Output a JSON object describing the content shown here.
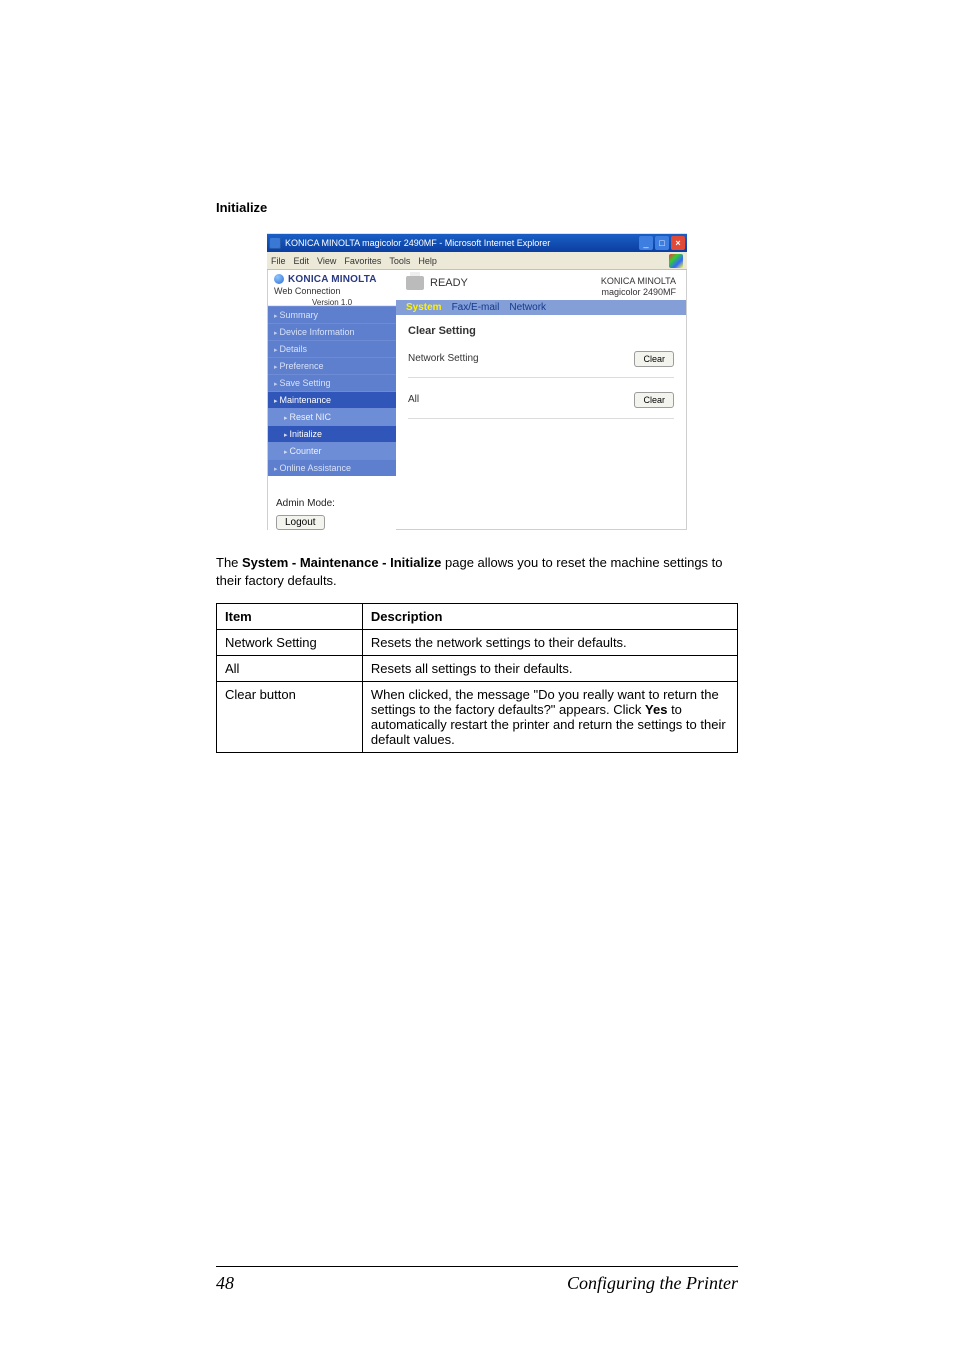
{
  "section_heading": "Initialize",
  "screenshot": {
    "window_title": "KONICA MINOLTA magicolor 2490MF - Microsoft Internet Explorer",
    "win_min": "_",
    "win_max": "□",
    "win_close": "×",
    "menu": {
      "file": "File",
      "edit": "Edit",
      "view": "View",
      "favorites": "Favorites",
      "tools": "Tools",
      "help": "Help"
    },
    "brand": {
      "name": "KONICA MINOLTA",
      "product": "Web Connection",
      "version": "Version 1.0"
    },
    "nav": {
      "summary": "Summary",
      "device_info": "Device Information",
      "details": "Details",
      "preference": "Preference",
      "save_setting": "Save Setting",
      "maintenance": "Maintenance",
      "reset_nic": "Reset NIC",
      "initialize": "Initialize",
      "counter": "Counter",
      "online_assistance": "Online Assistance"
    },
    "admin_section": {
      "label": "Admin Mode:",
      "logout": "Logout"
    },
    "status": {
      "ready": "READY",
      "brand_right_1": "KONICA MINOLTA",
      "brand_right_2": "magicolor 2490MF"
    },
    "tabs": {
      "system": "System",
      "fax": "Fax/E-mail",
      "network": "Network"
    },
    "panel": {
      "heading": "Clear Setting",
      "row1_label": "Network Setting",
      "row2_label": "All",
      "clear_label": "Clear"
    }
  },
  "paragraph": {
    "pre": "The ",
    "strong": "System - Maintenance - Initialize",
    "post": " page allows you to reset the machine settings to their factory defaults."
  },
  "table": {
    "head_item": "Item",
    "head_desc": "Description",
    "rows": [
      {
        "item": "Network Setting",
        "desc": "Resets the network settings to their defaults."
      },
      {
        "item": "All",
        "desc": "Resets all settings to their defaults."
      },
      {
        "item": "Clear button",
        "desc_pre": "When clicked, the message \"Do you really want to return the settings to the factory defaults?\" appears. Click ",
        "desc_bold": "Yes",
        "desc_post": " to automatically restart the printer and return the settings to their default values."
      }
    ]
  },
  "footer": {
    "page": "48",
    "chapter": "Configuring the Printer"
  }
}
